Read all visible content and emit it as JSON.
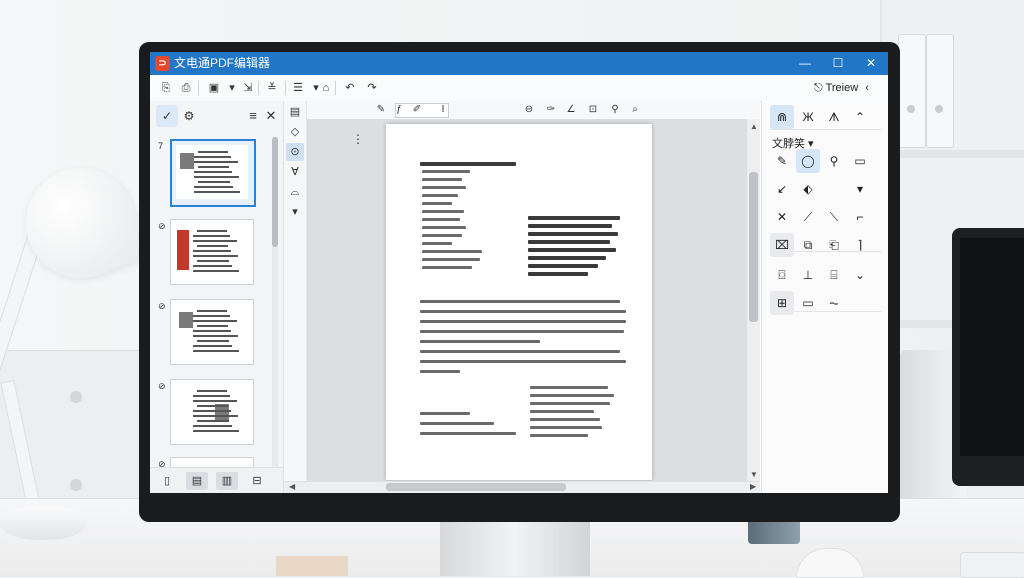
{
  "window": {
    "title": "文电通PDF编辑器",
    "app_icon": "app-logo-icon",
    "controls": {
      "minimize": "—",
      "maximize": "☐",
      "close": "✕"
    }
  },
  "toolbar": {
    "items": [
      {
        "name": "open-icon",
        "glyph": "⎘"
      },
      {
        "name": "print-icon",
        "glyph": "⎙"
      },
      {
        "name": "save-icon",
        "glyph": "▣"
      },
      {
        "name": "dropdown-icon",
        "glyph": "▾"
      },
      {
        "name": "export-icon",
        "glyph": "⇲"
      },
      {
        "name": "align-icon",
        "glyph": "≚"
      },
      {
        "name": "format-icon",
        "glyph": "☰"
      },
      {
        "name": "more-icon",
        "glyph": "▾"
      },
      {
        "name": "stamp-icon",
        "glyph": "⌂"
      },
      {
        "name": "undo-icon",
        "glyph": "↶"
      },
      {
        "name": "redo-icon",
        "glyph": "↷"
      }
    ],
    "preview_label": "Treiew",
    "preview_icon": "preview-icon"
  },
  "left_panel": {
    "tabs": [
      {
        "name": "tab-pages-icon",
        "glyph": "✓",
        "active": true
      },
      {
        "name": "tab-bookmarks-icon",
        "glyph": "⚙",
        "active": false
      }
    ],
    "menu_glyph": "≡",
    "close_glyph": "✕",
    "thumbnails": [
      {
        "marker": "7",
        "selected": true
      },
      {
        "marker": "⊘",
        "selected": false
      },
      {
        "marker": "⊘",
        "selected": false
      },
      {
        "marker": "⊘",
        "selected": false
      },
      {
        "marker": "⊘",
        "selected": false
      }
    ],
    "bottom_buttons": [
      {
        "name": "single-page-icon",
        "glyph": "▯"
      },
      {
        "name": "page-view-icon",
        "glyph": "▤"
      },
      {
        "name": "grid-view-icon",
        "glyph": "▥"
      },
      {
        "name": "folder-icon",
        "glyph": "⊟"
      }
    ]
  },
  "vertical_tools": [
    {
      "name": "select-tool-icon",
      "glyph": "▤",
      "active": false
    },
    {
      "name": "hand-tool-icon",
      "glyph": "◇",
      "active": false
    },
    {
      "name": "zoom-tool-icon",
      "glyph": "⊙",
      "active": true
    },
    {
      "name": "pen-tool-icon",
      "glyph": "∀",
      "active": false
    },
    {
      "name": "shape-tool-icon",
      "glyph": "⌓",
      "active": false
    },
    {
      "name": "expand-icon",
      "glyph": "▾",
      "active": false
    }
  ],
  "doc_toolbar": {
    "items": [
      {
        "name": "draw-icon",
        "glyph": "✎"
      },
      {
        "name": "highlight-icon",
        "glyph": "ƒ"
      },
      {
        "name": "marker-icon",
        "glyph": "✐"
      },
      {
        "name": "text-cursor-icon",
        "glyph": "I"
      },
      {
        "name": "zoom-out-icon",
        "glyph": "⊖"
      },
      {
        "name": "brush-icon",
        "glyph": "✑"
      },
      {
        "name": "eraser-icon",
        "glyph": "∠"
      },
      {
        "name": "crop-icon",
        "glyph": "⊡"
      },
      {
        "name": "find-icon",
        "glyph": "⚲"
      },
      {
        "name": "search-icon",
        "glyph": "⌕"
      }
    ],
    "more_glyph": "⋮"
  },
  "right_panel": {
    "top_buttons": [
      {
        "name": "comment-tool-icon",
        "glyph": "⋒",
        "active": true
      },
      {
        "name": "sign-tool-icon",
        "glyph": "Ж",
        "active": false
      },
      {
        "name": "stamp-tool-icon",
        "glyph": "ᗑ",
        "active": false
      },
      {
        "name": "collapse-icon",
        "glyph": "⌃",
        "active": false
      }
    ],
    "section_label": "文脖笑 ▾",
    "rows": [
      [
        {
          "name": "pencil-icon",
          "glyph": "✎",
          "state": ""
        },
        {
          "name": "circle-icon",
          "glyph": "◯",
          "state": "active"
        },
        {
          "name": "magnifier-icon",
          "glyph": "⚲",
          "state": ""
        },
        {
          "name": "rectangle-icon",
          "glyph": "▭",
          "state": ""
        }
      ],
      [
        {
          "name": "arrow-icon",
          "glyph": "↙",
          "state": ""
        },
        {
          "name": "polygon-icon",
          "glyph": "⬖",
          "state": ""
        },
        {
          "name": "blank-slot-icon",
          "glyph": "",
          "state": ""
        },
        {
          "name": "dropdown-icon",
          "glyph": "▾",
          "state": ""
        }
      ],
      [
        {
          "name": "cross-icon",
          "glyph": "✕",
          "state": ""
        },
        {
          "name": "check-pen-icon",
          "glyph": "⟋",
          "state": ""
        },
        {
          "name": "line-icon",
          "glyph": "⟍",
          "state": ""
        },
        {
          "name": "hook-icon",
          "glyph": "⌐",
          "state": ""
        }
      ],
      [
        {
          "name": "note-icon",
          "glyph": "⌧",
          "state": "gray"
        },
        {
          "name": "copy-icon",
          "glyph": "⧉",
          "state": ""
        },
        {
          "name": "paste-icon",
          "glyph": "⎗",
          "state": ""
        },
        {
          "name": "text-insert-icon",
          "glyph": "⌉",
          "state": ""
        }
      ],
      [
        {
          "name": "attach-icon",
          "glyph": "⌼",
          "state": ""
        },
        {
          "name": "anchor-icon",
          "glyph": "⊥",
          "state": ""
        },
        {
          "name": "frame-icon",
          "glyph": "⌸",
          "state": ""
        },
        {
          "name": "more-down-icon",
          "glyph": "⌄",
          "state": ""
        }
      ],
      [
        {
          "name": "image-icon",
          "glyph": "⊞",
          "state": "gray"
        },
        {
          "name": "link-icon",
          "glyph": "▭",
          "state": ""
        },
        {
          "name": "signature-icon",
          "glyph": "⏦",
          "state": ""
        }
      ]
    ]
  },
  "colors": {
    "titlebar": "#2176c7",
    "accent": "#2a82d8",
    "active_bg": "#d6e6f7"
  }
}
